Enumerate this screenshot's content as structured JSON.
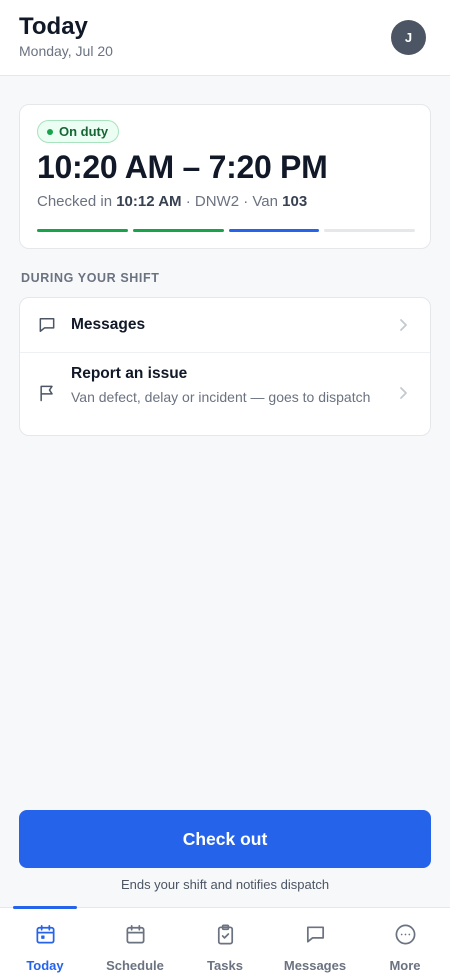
{
  "header": {
    "title": "Today",
    "date": "Monday, Jul 20",
    "avatar_initial": "J"
  },
  "shift": {
    "status": "On duty",
    "time_range": "10:20 AM – 7:20 PM",
    "checked_in_label": "Checked in",
    "checked_in_time": "10:12 AM",
    "sep1": " · ",
    "station": "DNW2",
    "sep2": " · ",
    "van_label": "Van",
    "van_number": "103",
    "progress_segments": [
      "done",
      "done",
      "current",
      "upcoming"
    ]
  },
  "section_label": "DURING YOUR SHIFT",
  "actions": [
    {
      "title": "Messages",
      "icon": "chat-bubble-icon"
    },
    {
      "title": "Report an issue",
      "subtitle": "Van defect, delay or incident — goes to dispatch",
      "icon": "flag-icon"
    }
  ],
  "checkout": {
    "label": "Check out",
    "hint": "Ends your shift and notifies dispatch"
  },
  "tabs": [
    {
      "label": "Today",
      "icon": "calendar-today-icon",
      "active": true
    },
    {
      "label": "Schedule",
      "icon": "calendar-icon",
      "active": false
    },
    {
      "label": "Tasks",
      "icon": "clipboard-check-icon",
      "active": false
    },
    {
      "label": "Messages",
      "icon": "chat-bubble-icon",
      "active": false
    },
    {
      "label": "More",
      "icon": "more-circle-icon",
      "active": false
    }
  ],
  "colors": {
    "accent": "#2563eb",
    "success": "#16a34a",
    "avatar": "#4b5563"
  }
}
